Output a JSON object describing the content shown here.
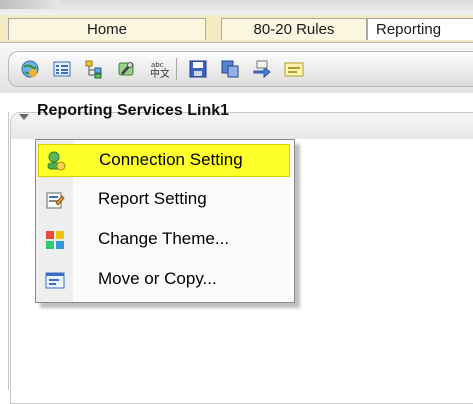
{
  "tabs": [
    {
      "label": "Home"
    },
    {
      "label": "80-20 Rules"
    },
    {
      "label": "Reporting"
    }
  ],
  "toolbar": {
    "icons": [
      "globe-icon",
      "list-icon",
      "tree-icon",
      "tools-icon",
      "abc-spellcheck-icon",
      "save-icon",
      "copy-icon",
      "export-icon",
      "notes-icon"
    ]
  },
  "panel": {
    "title": "Reporting Services Link1"
  },
  "context_menu": {
    "items": [
      {
        "label": "Connection Setting",
        "icon": "connection-icon",
        "highlighted": true
      },
      {
        "label": "Report Setting",
        "icon": "report-settings-icon",
        "highlighted": false
      },
      {
        "label": "Change Theme...",
        "icon": "theme-palette-icon",
        "highlighted": false
      },
      {
        "label": "Move or Copy...",
        "icon": "move-copy-icon",
        "highlighted": false
      }
    ]
  },
  "colors": {
    "tabbar_bg": "#f3ecc3",
    "menu_highlight": "#ffff2a"
  }
}
